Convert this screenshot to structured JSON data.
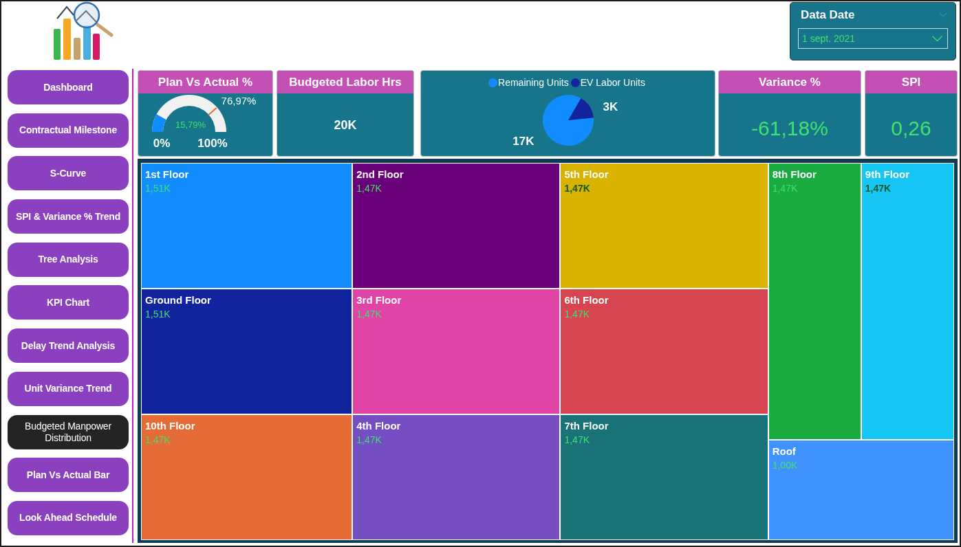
{
  "data_date": {
    "title": "Data Date",
    "value": "1 sept. 2021"
  },
  "nav": [
    {
      "label": "Dashboard",
      "selected": false
    },
    {
      "label": "Contractual Milestone",
      "selected": false
    },
    {
      "label": "S-Curve",
      "selected": false
    },
    {
      "label": "SPI & Variance % Trend",
      "selected": false
    },
    {
      "label": "Tree Analysis",
      "selected": false
    },
    {
      "label": "KPI Chart",
      "selected": false
    },
    {
      "label": "Delay Trend Analysis",
      "selected": false
    },
    {
      "label": "Unit Variance Trend",
      "selected": false
    },
    {
      "label": "Budgeted Manpower Distribution",
      "selected": true
    },
    {
      "label": "Plan Vs Actual Bar",
      "selected": false
    },
    {
      "label": "Look Ahead Schedule",
      "selected": false
    }
  ],
  "cards": [
    {
      "kind": "gauge",
      "title": "Plan Vs Actual %",
      "gauge": {
        "level": 0.1579,
        "value": "15,79%",
        "min": "0%",
        "max": "100%",
        "target": {
          "level": 0.7697,
          "label": "76,97%"
        }
      }
    },
    {
      "kind": "value",
      "title": "Budgeted Labor Hrs",
      "value": "20K"
    },
    {
      "kind": "pie",
      "chart_data": {
        "type": "pie",
        "legend": "top",
        "categories": [
          "Remaining Units",
          "EV Labor Units"
        ],
        "values": [
          17,
          3
        ],
        "colors": [
          "#118dff",
          "#12239e"
        ],
        "value_labels": [
          "17K",
          "3K"
        ]
      }
    },
    {
      "kind": "metric",
      "title": "Variance %",
      "value": "-61,18%"
    },
    {
      "kind": "metric",
      "title": "SPI",
      "value": "0,26"
    }
  ],
  "treemap": {
    "tiles": [
      {
        "label": "1st Floor",
        "value": "1,51K",
        "color": "#118dff"
      },
      {
        "label": "Ground Floor",
        "value": "1,51K",
        "color": "#12239e"
      },
      {
        "label": "10th Floor",
        "value": "1,47K",
        "color": "#e66c37"
      },
      {
        "label": "2nd Floor",
        "value": "1,47K",
        "color": "#6b007b"
      },
      {
        "label": "3rd Floor",
        "value": "1,47K",
        "color": "#e044a7"
      },
      {
        "label": "4th Floor",
        "value": "1,47K",
        "color": "#744ec2"
      },
      {
        "label": "5th Floor",
        "value": "1,47K",
        "color": "#d9b300"
      },
      {
        "label": "6th Floor",
        "value": "1,47K",
        "color": "#d64550"
      },
      {
        "label": "7th Floor",
        "value": "1,47K",
        "color": "#197278"
      },
      {
        "label": "8th Floor",
        "value": "1,47K",
        "color": "#1aab40"
      },
      {
        "label": "9th Floor",
        "value": "1,47K",
        "color": "#15c5f4"
      },
      {
        "label": "Roof",
        "value": "1,00K",
        "color": "#4092ff"
      }
    ]
  }
}
